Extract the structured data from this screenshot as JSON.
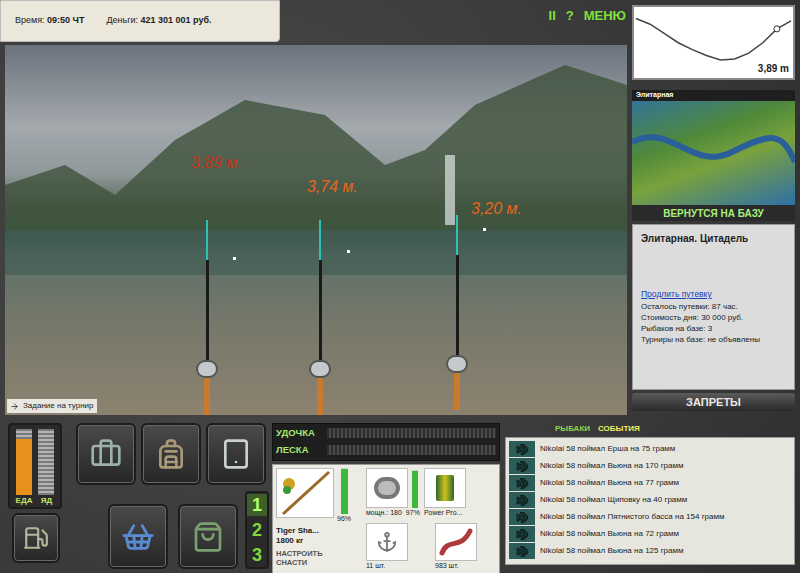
{
  "status": {
    "time_label": "Время:",
    "time": "09:50 ЧТ",
    "money_label": "Деньги:",
    "money": "421 301 001 руб."
  },
  "menu": [
    "II",
    "?",
    "МЕНЮ"
  ],
  "scene": {
    "rods": [
      {
        "depth": "3,89 м.",
        "color": "#c4341c"
      },
      {
        "depth": "3,74 м.",
        "color": "#e8661c"
      },
      {
        "depth": "3,20 м.",
        "color": "#e8661c"
      }
    ],
    "task_button": "Задание на турнир"
  },
  "depth_chart": {
    "reading": "3,89 m",
    "profile": [
      0.3,
      0.8,
      1.6,
      2.4,
      3.0,
      3.5,
      3.9,
      3.8,
      3.3,
      2.4,
      1.2,
      0.5
    ],
    "marker_index": 10
  },
  "map": {
    "title": "Элитарная"
  },
  "return_button": "ВЕРНУТСЯ НА БАЗУ",
  "base_info": {
    "title": "Элитарная. Цитадель",
    "link": "Продлить путевку",
    "lines": [
      "Осталось путевки: 87 час.",
      "Стоимость дня: 30 000 руб.",
      "Рыбаков на базе: 3",
      "Турниры на базе: не объявлены"
    ]
  },
  "bans_button": "ЗАПРЕТЫ",
  "meters": [
    {
      "label": "ЕДА",
      "level": 0.85,
      "color": "#e8901c"
    },
    {
      "label": "ЯД",
      "level": 0.0,
      "color": "#9a9a9a"
    }
  ],
  "slots": [
    {
      "label": "1",
      "selected": true
    },
    {
      "label": "2",
      "selected": false
    },
    {
      "label": "3",
      "selected": false
    }
  ],
  "tension": [
    {
      "label": "УДОЧКА",
      "level": 0
    },
    {
      "label": "ЛЕСКА",
      "level": 0
    }
  ],
  "tackle": {
    "rod": {
      "name": "Tiger Sha...",
      "strength": "1800 кг",
      "condition": "96%",
      "level": 0.96
    },
    "reel": {
      "power": "мощн.: 180",
      "condition": "97%",
      "level": 0.97
    },
    "line": {
      "name": "Power Pro..."
    },
    "hook": {
      "count": "11 шт."
    },
    "bait": {
      "count": "983 шт."
    },
    "setup_button": "НАСТРОИТЬ СНАСТИ"
  },
  "tabs": [
    {
      "label": "РЫБАКИ",
      "selected": false
    },
    {
      "label": "СОБЫТИЯ",
      "selected": true
    }
  ],
  "events": [
    "Nikolai 58 поймал Ерша на 75 грамм",
    "Nikolai 58 поймал Вьюна на 170 грамм",
    "Nikolai 58 поймал Вьюна на 77 грамм",
    "Nikolai 58 поймал Щиповку на 40 грамм",
    "Nikolai 58 поймал Пятнистого басса на 154 грамм",
    "Nikolai 58 поймал Вьюна на 72 грамм",
    "Nikolai 58 поймал Вьюна на 125 грамм"
  ]
}
